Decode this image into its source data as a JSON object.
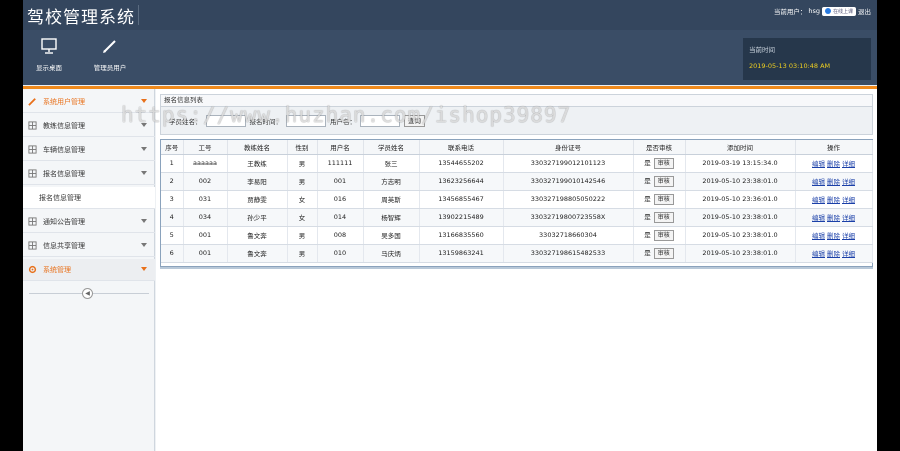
{
  "header": {
    "app_title": "驾校管理系统",
    "user_prefix": "当前用户：",
    "username": "hsg",
    "status_chip": "在线上课",
    "logout": "退出"
  },
  "toolbar": {
    "items": [
      {
        "label": "显示桌面",
        "icon": "monitor-icon"
      },
      {
        "label": "管理员用户",
        "icon": "pencil-icon"
      }
    ],
    "time_label": "当前时间",
    "time_value": "2019-05-13 03:10:48 AM"
  },
  "sidebar": {
    "items": [
      {
        "label": "系统用户管理",
        "icon": "pencil-icon",
        "active": true
      },
      {
        "label": "教练信息管理",
        "icon": "grid-icon"
      },
      {
        "label": "车辆信息管理",
        "icon": "grid-icon"
      },
      {
        "label": "报名信息管理",
        "icon": "grid-icon"
      },
      {
        "label": "报名信息管理",
        "icon": "none",
        "sub": true
      },
      {
        "label": "通知公告管理",
        "icon": "grid-icon"
      },
      {
        "label": "信息共享管理",
        "icon": "grid-icon"
      },
      {
        "label": "系统管理",
        "icon": "gear-icon",
        "active": true
      }
    ],
    "collapse_glyph": "◀"
  },
  "main": {
    "panel_title": "报名信息列表",
    "search": {
      "label1": "学员姓名：",
      "label2": "报名时间：",
      "label3": "用户名：",
      "button": "查询"
    },
    "table": {
      "headers": [
        "序号",
        "工号",
        "教练姓名",
        "性别",
        "用户名",
        "学员姓名",
        "联系电话",
        "身份证号",
        "是否审核",
        "添加时间",
        "操作"
      ],
      "rows": [
        [
          "1",
          "aaaaaa",
          "王教练",
          "男",
          "111111",
          "张三",
          "13544655202",
          "330327199012101123",
          "是",
          "2019-03-19 13:15:34.0"
        ],
        [
          "2",
          "002",
          "李易阳",
          "男",
          "001",
          "方志明",
          "13623256644",
          "330327199010142546",
          "是",
          "2019-05-10 23:38:01.0"
        ],
        [
          "3",
          "031",
          "贾静雯",
          "女",
          "016",
          "周英斯",
          "13456855467",
          "330327198805050222",
          "是",
          "2019-05-10 23:36:01.0"
        ],
        [
          "4",
          "034",
          "孙少平",
          "女",
          "014",
          "杨智辉",
          "13902215489",
          "33032719800723558X",
          "是",
          "2019-05-10 23:38:01.0"
        ],
        [
          "5",
          "001",
          "鲁文奔",
          "男",
          "008",
          "吴多国",
          "13166835560",
          "33032718660304",
          "是",
          "2019-05-10 23:38:01.0"
        ],
        [
          "6",
          "001",
          "鲁文奔",
          "男",
          "010",
          "马庆炳",
          "13159863241",
          "330327198615482533",
          "是",
          "2019-05-10 23:38:01.0"
        ]
      ],
      "review_label": "审核",
      "actions": [
        "编辑",
        "删除",
        "详细"
      ]
    }
  },
  "watermark": "https://www.huzhan.com/ishop39897"
}
